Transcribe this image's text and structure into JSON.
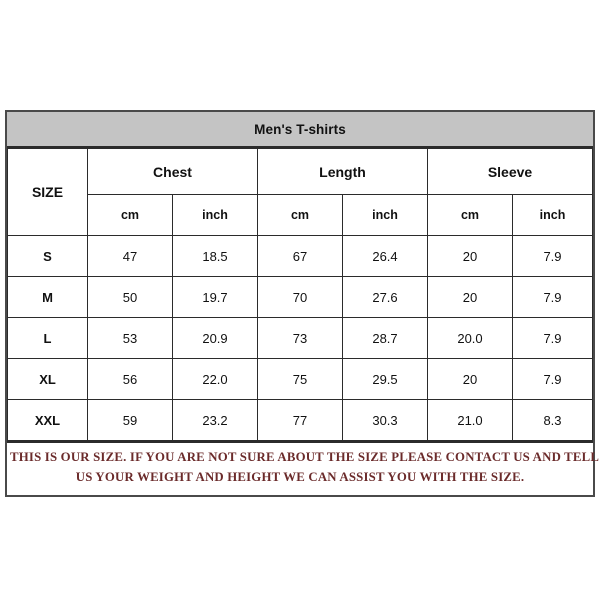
{
  "table": {
    "title": "Men's T-shirts",
    "size_header": "SIZE",
    "groups": [
      {
        "label": "Chest"
      },
      {
        "label": "Length"
      },
      {
        "label": "Sleeve"
      }
    ],
    "units": [
      "cm",
      "inch",
      "cm",
      "inch",
      "cm",
      "inch"
    ],
    "rows": [
      {
        "size": "S",
        "chest_cm": "47",
        "chest_inch": "18.5",
        "length_cm": "67",
        "length_inch": "26.4",
        "sleeve_cm": "20",
        "sleeve_inch": "7.9"
      },
      {
        "size": "M",
        "chest_cm": "50",
        "chest_inch": "19.7",
        "length_cm": "70",
        "length_inch": "27.6",
        "sleeve_cm": "20",
        "sleeve_inch": "7.9"
      },
      {
        "size": "L",
        "chest_cm": "53",
        "chest_inch": "20.9",
        "length_cm": "73",
        "length_inch": "28.7",
        "sleeve_cm": "20.0",
        "sleeve_inch": "7.9"
      },
      {
        "size": "XL",
        "chest_cm": "56",
        "chest_inch": "22.0",
        "length_cm": "75",
        "length_inch": "29.5",
        "sleeve_cm": "20",
        "sleeve_inch": "7.9"
      },
      {
        "size": "XXL",
        "chest_cm": "59",
        "chest_inch": "23.2",
        "length_cm": "77",
        "length_inch": "30.3",
        "sleeve_cm": "21.0",
        "sleeve_inch": "8.3"
      }
    ],
    "footer": {
      "line1": "THIS IS OUR SIZE. IF YOU ARE NOT SURE ABOUT THE SIZE  PLEASE CONTACT US AND TELL",
      "line2": "US YOUR WEIGHT AND HEIGHT WE CAN ASSIST YOU WITH THE SIZE."
    },
    "colors": {
      "title_bar": "#c4c4c4",
      "grid_line": "#2b2b2b",
      "outer_border": "#4a4a4a",
      "footer_text": "#6b2b2b",
      "background": "#ffffff"
    }
  }
}
